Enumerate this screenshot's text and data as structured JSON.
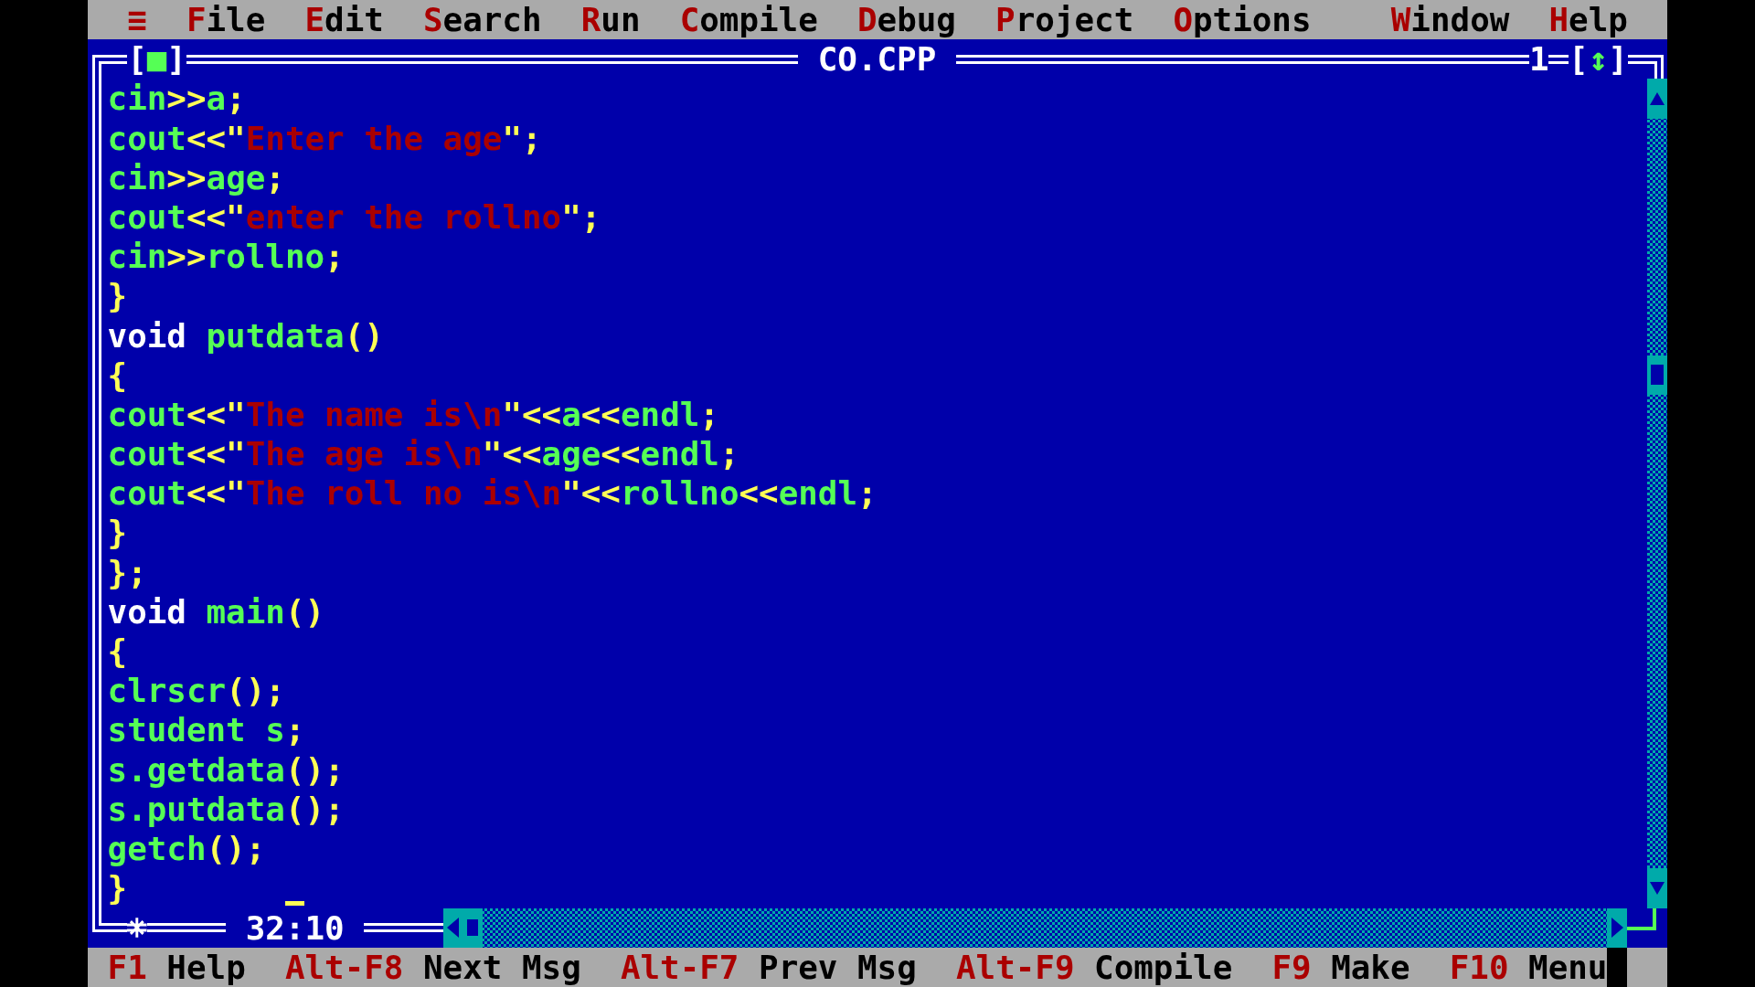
{
  "menu_bar": {
    "system_menu": "≡",
    "items": [
      {
        "label": "File"
      },
      {
        "label": "Edit"
      },
      {
        "label": "Search"
      },
      {
        "label": "Run"
      },
      {
        "label": "Compile"
      },
      {
        "label": "Debug"
      },
      {
        "label": "Project"
      },
      {
        "label": "Options"
      }
    ],
    "right_items": [
      {
        "label": "Window"
      },
      {
        "label": "Help"
      }
    ]
  },
  "editor": {
    "close_button": "[■]",
    "title": "CO.CPP",
    "window_number": "1",
    "zoom_button": "[↕]",
    "lines": [
      {
        "tokens": [
          {
            "kind": "ident",
            "text": "cin"
          },
          {
            "kind": "punct",
            "text": ">>"
          },
          {
            "kind": "ident",
            "text": "a"
          },
          {
            "kind": "punct",
            "text": ";"
          }
        ]
      },
      {
        "tokens": [
          {
            "kind": "ident",
            "text": "cout"
          },
          {
            "kind": "punct",
            "text": "<<\""
          },
          {
            "kind": "string",
            "text": "Enter the age"
          },
          {
            "kind": "punct",
            "text": "\";"
          }
        ]
      },
      {
        "tokens": [
          {
            "kind": "ident",
            "text": "cin"
          },
          {
            "kind": "punct",
            "text": ">>"
          },
          {
            "kind": "ident",
            "text": "age"
          },
          {
            "kind": "punct",
            "text": ";"
          }
        ]
      },
      {
        "tokens": [
          {
            "kind": "ident",
            "text": "cout"
          },
          {
            "kind": "punct",
            "text": "<<\""
          },
          {
            "kind": "string",
            "text": "enter the rollno"
          },
          {
            "kind": "punct",
            "text": "\";"
          }
        ]
      },
      {
        "tokens": [
          {
            "kind": "ident",
            "text": "cin"
          },
          {
            "kind": "punct",
            "text": ">>"
          },
          {
            "kind": "ident",
            "text": "rollno"
          },
          {
            "kind": "punct",
            "text": ";"
          }
        ]
      },
      {
        "tokens": [
          {
            "kind": "punct",
            "text": "}"
          }
        ]
      },
      {
        "tokens": [
          {
            "kind": "keyword",
            "text": "void"
          },
          {
            "kind": "ident",
            "text": " putdata"
          },
          {
            "kind": "punct",
            "text": "()"
          }
        ]
      },
      {
        "tokens": [
          {
            "kind": "punct",
            "text": "{"
          }
        ]
      },
      {
        "tokens": [
          {
            "kind": "ident",
            "text": "cout"
          },
          {
            "kind": "punct",
            "text": "<<\""
          },
          {
            "kind": "string",
            "text": "The name is\\n"
          },
          {
            "kind": "punct",
            "text": "\"<<"
          },
          {
            "kind": "ident",
            "text": "a"
          },
          {
            "kind": "punct",
            "text": "<<"
          },
          {
            "kind": "ident",
            "text": "endl"
          },
          {
            "kind": "punct",
            "text": ";"
          }
        ]
      },
      {
        "tokens": [
          {
            "kind": "ident",
            "text": "cout"
          },
          {
            "kind": "punct",
            "text": "<<\""
          },
          {
            "kind": "string",
            "text": "The age is\\n"
          },
          {
            "kind": "punct",
            "text": "\"<<"
          },
          {
            "kind": "ident",
            "text": "age"
          },
          {
            "kind": "punct",
            "text": "<<"
          },
          {
            "kind": "ident",
            "text": "endl"
          },
          {
            "kind": "punct",
            "text": ";"
          }
        ]
      },
      {
        "tokens": [
          {
            "kind": "ident",
            "text": "cout"
          },
          {
            "kind": "punct",
            "text": "<<\""
          },
          {
            "kind": "string",
            "text": "The roll no is\\n"
          },
          {
            "kind": "punct",
            "text": "\"<<"
          },
          {
            "kind": "ident",
            "text": "rollno"
          },
          {
            "kind": "punct",
            "text": "<<"
          },
          {
            "kind": "ident",
            "text": "endl"
          },
          {
            "kind": "punct",
            "text": ";"
          }
        ]
      },
      {
        "tokens": [
          {
            "kind": "punct",
            "text": "}"
          }
        ]
      },
      {
        "tokens": [
          {
            "kind": "punct",
            "text": "};"
          }
        ]
      },
      {
        "tokens": [
          {
            "kind": "keyword",
            "text": "void"
          },
          {
            "kind": "ident",
            "text": " main"
          },
          {
            "kind": "punct",
            "text": "()"
          }
        ]
      },
      {
        "tokens": [
          {
            "kind": "punct",
            "text": "{"
          }
        ]
      },
      {
        "tokens": [
          {
            "kind": "ident",
            "text": "clrscr"
          },
          {
            "kind": "punct",
            "text": "();"
          }
        ]
      },
      {
        "tokens": [
          {
            "kind": "ident",
            "text": "student s"
          },
          {
            "kind": "punct",
            "text": ";"
          }
        ]
      },
      {
        "tokens": [
          {
            "kind": "ident",
            "text": "s.getdata"
          },
          {
            "kind": "punct",
            "text": "();"
          }
        ]
      },
      {
        "tokens": [
          {
            "kind": "ident",
            "text": "s.putdata"
          },
          {
            "kind": "punct",
            "text": "();"
          }
        ]
      },
      {
        "tokens": [
          {
            "kind": "ident",
            "text": "getch"
          },
          {
            "kind": "punct",
            "text": "();"
          }
        ]
      },
      {
        "tokens": [
          {
            "kind": "punct",
            "text": "}"
          }
        ]
      }
    ],
    "cursor_position": "32:10"
  },
  "status_bar": [
    {
      "key": "F1",
      "label": "Help"
    },
    {
      "key": "Alt-F8",
      "label": "Next Msg"
    },
    {
      "key": "Alt-F7",
      "label": "Prev Msg"
    },
    {
      "key": "Alt-F9",
      "label": "Compile"
    },
    {
      "key": "F9",
      "label": "Make"
    },
    {
      "key": "F10",
      "label": "Menu"
    }
  ]
}
